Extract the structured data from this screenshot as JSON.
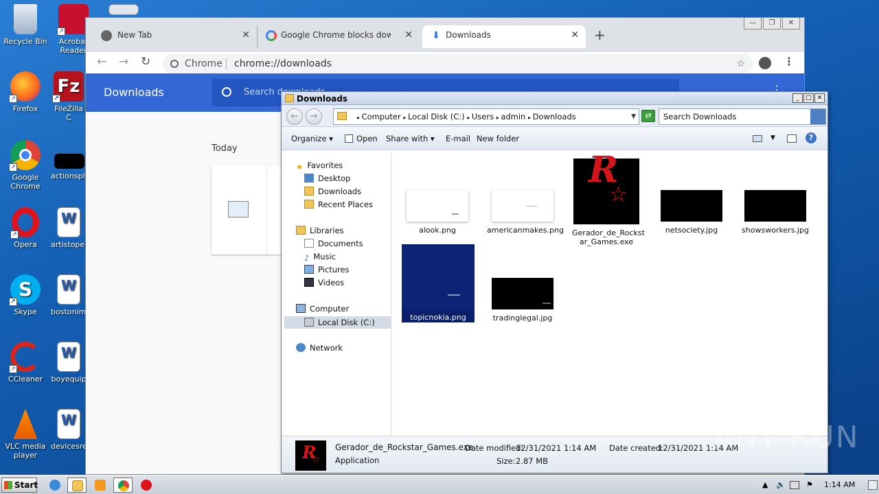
{
  "desktop": {
    "icons": [
      {
        "label": "Recycle Bin",
        "icon": "recycle-bin-icon"
      },
      {
        "label": "Acrobat Reader",
        "icon": "acrobat-icon"
      },
      {
        "label": "Firefox",
        "icon": "firefox-icon"
      },
      {
        "label": "FileZilla C",
        "icon": "filezilla-icon"
      },
      {
        "label": "Google Chrome",
        "icon": "chrome-icon"
      },
      {
        "label": "actionspir",
        "icon": "file-icon"
      },
      {
        "label": "Opera",
        "icon": "opera-icon"
      },
      {
        "label": "artistoper",
        "icon": "word-doc-icon"
      },
      {
        "label": "Skype",
        "icon": "skype-icon"
      },
      {
        "label": "bostonimp",
        "icon": "word-doc-icon"
      },
      {
        "label": "CCleaner",
        "icon": "ccleaner-icon"
      },
      {
        "label": "boyequip",
        "icon": "word-doc-icon"
      },
      {
        "label": "VLC media player",
        "icon": "vlc-icon"
      },
      {
        "label": "devicesre",
        "icon": "word-doc-icon"
      }
    ]
  },
  "chrome": {
    "tabs": [
      {
        "label": "New Tab",
        "icon": "globe-icon"
      },
      {
        "label": "Google Chrome blocks downloads - G",
        "icon": "google-icon"
      },
      {
        "label": "Downloads",
        "icon": "download-icon"
      }
    ],
    "omnibox": {
      "site": "Chrome",
      "url": "chrome://downloads"
    },
    "page": {
      "title": "Downloads",
      "search_placeholder": "Search downloads",
      "section": "Today"
    }
  },
  "explorer": {
    "title": "Downloads",
    "breadcrumb": [
      "Computer",
      "Local Disk (C:)",
      "Users",
      "admin",
      "Downloads"
    ],
    "search_placeholder": "Search Downloads",
    "commands": {
      "organize": "Organize",
      "open": "Open",
      "share": "Share with",
      "email": "E-mail",
      "new_folder": "New folder"
    },
    "nav": {
      "favorites": "Favorites",
      "desktop": "Desktop",
      "downloads": "Downloads",
      "recent": "Recent Places",
      "libraries": "Libraries",
      "documents": "Documents",
      "music": "Music",
      "pictures": "Pictures",
      "videos": "Videos",
      "computer": "Computer",
      "local_disk": "Local Disk (C:)",
      "network": "Network"
    },
    "files": [
      {
        "name": "alook.png"
      },
      {
        "name": "americanmakes.png"
      },
      {
        "name": "Gerador_de_Rockst",
        "name2": "ar_Games.exe"
      },
      {
        "name": "netsociety.jpg"
      },
      {
        "name": "showsworkers.jpg"
      },
      {
        "name": "topicnokia.png"
      },
      {
        "name": "tradinglegal.jpg"
      }
    ],
    "status": {
      "filename": "Gerador_de_Rockstar_Games.exe",
      "type": "Application",
      "modified_label": "Date modified:",
      "modified": "12/31/2021 1:14 AM",
      "created_label": "Date created:",
      "created": "12/31/2021 1:14 AM",
      "size_label": "Size:",
      "size": "2.87 MB"
    }
  },
  "taskbar": {
    "start": "Start",
    "clock": "1:14 AM"
  },
  "watermark": "ANY RUN"
}
